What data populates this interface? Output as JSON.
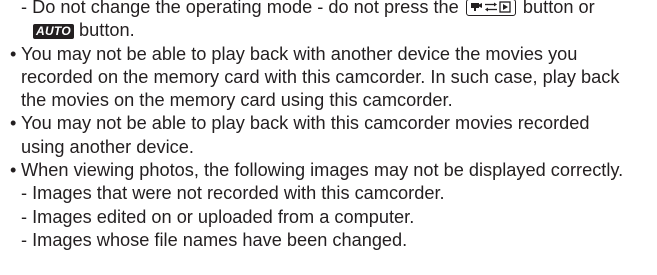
{
  "notes": {
    "mode_note_before": "- Do not change the operating mode - do not press the",
    "mode_note_after": "button or",
    "auto_badge": "AUTO",
    "mode_note_end": "button.",
    "bullet_symbol": "•",
    "bullet1": [
      "You may not be able to play back with another device the movies you",
      "recorded on the memory card with this camcorder. In such case, play back",
      "the movies on the memory card using this camcorder."
    ],
    "bullet2": [
      "You may not be able to play back with this camcorder movies recorded",
      "using another device."
    ],
    "bullet3": [
      "When viewing photos, the following images may not be displayed correctly."
    ],
    "sub_items": [
      "- Images that were not recorded with this camcorder.",
      "- Images edited on or uploaded from a computer.",
      "- Images whose file names have been changed."
    ]
  },
  "icons": {
    "mode_button": "camera-playback-mode-icon"
  },
  "colors": {
    "text": "#231f20",
    "background": "#ffffff"
  }
}
